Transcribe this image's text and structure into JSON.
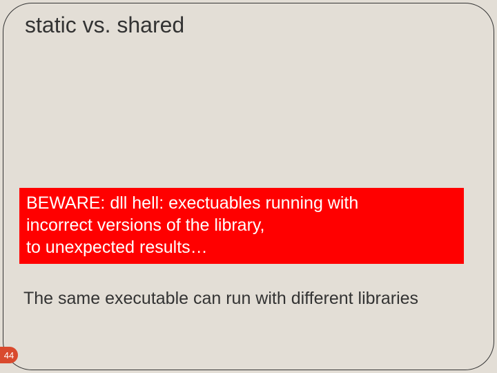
{
  "slide": {
    "title": "static vs. shared",
    "warning": {
      "line1": "BEWARE: dll hell: exectuables running with",
      "line2": "incorrect versions of the library,",
      "line3": "to unexpected results…"
    },
    "body": "The same executable can run with different libraries",
    "page_number": "44"
  }
}
